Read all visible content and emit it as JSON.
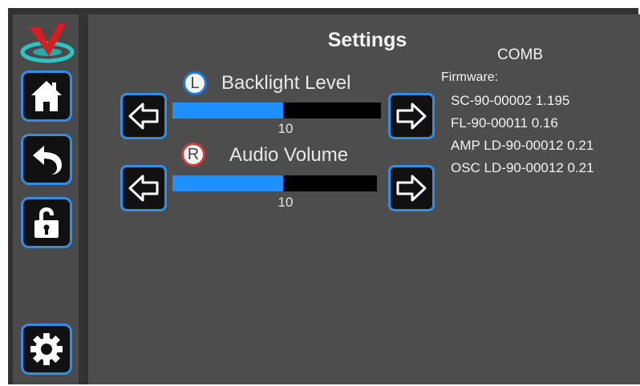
{
  "sidebar": {
    "logo": "v-logo-icon",
    "items": [
      {
        "id": "home",
        "icon": "home-icon"
      },
      {
        "id": "back",
        "icon": "back-arrow-icon"
      },
      {
        "id": "unlock",
        "icon": "unlock-icon"
      },
      {
        "id": "settings",
        "icon": "gear-icon"
      }
    ]
  },
  "header": {
    "title": "Settings"
  },
  "sliders": [
    {
      "badge": "L",
      "badge_color": "#1e78d7",
      "label": "Backlight Level",
      "value": "10",
      "fraction": 0.53
    },
    {
      "badge": "R",
      "badge_color": "#d23a3a",
      "label": "Audio Volume",
      "value": "10",
      "fraction": 0.54
    }
  ],
  "device": {
    "name": "COMB",
    "firmware_label": "Firmware:",
    "firmware": [
      "SC-90-00002 1.195",
      "FL-90-00011 0.16",
      "AMP LD-90-00012 0.21",
      "OSC LD-90-00012 0.21"
    ]
  },
  "colors": {
    "accent": "#1e90ff",
    "button_border": "#2f8fe6"
  }
}
